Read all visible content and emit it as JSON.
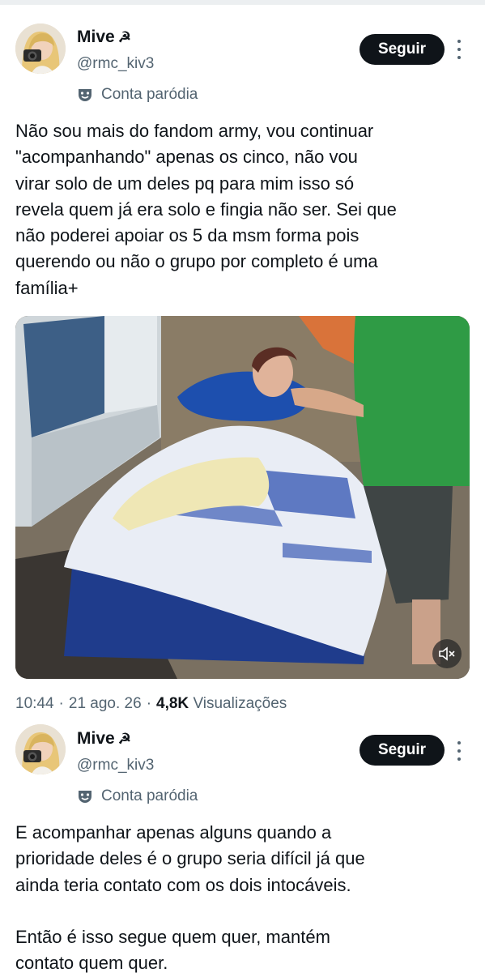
{
  "tweets": [
    {
      "author": {
        "name": "Mive",
        "symbol": "☭",
        "handle": "@rmc_kiv3",
        "avatar_icon": "avatar-photo-camera"
      },
      "follow_label": "Seguir",
      "parody_label": "Conta paródia",
      "text": "Não sou mais do fandom army, vou continuar\n\"acompanhando\" apenas os cinco, não vou\nvirar solo de um deles pq para mim isso só\nrevela quem já era solo e fingia não ser. Sei que\nnão poderei apoiar os 5 da msm forma pois\nquerendo ou não o grupo por completo é uma\nfamília+",
      "media": {
        "type": "video",
        "muted_icon": "speaker-muted-icon"
      },
      "meta": {
        "time": "10:44",
        "date": "21 ago. 26",
        "views_count": "4,8K",
        "views_label": "Visualizações",
        "separator": "·"
      }
    },
    {
      "author": {
        "name": "Mive",
        "symbol": "☭",
        "handle": "@rmc_kiv3",
        "avatar_icon": "avatar-photo-camera"
      },
      "follow_label": "Seguir",
      "parody_label": "Conta paródia",
      "text": "E acompanhar apenas alguns quando a\nprioridade deles é o grupo seria difícil já que\nainda teria contato com os dois intocáveis.\n\nEntão é isso segue quem quer, mantém\ncontato quem quer."
    }
  ],
  "colors": {
    "text": "#0f1419",
    "secondary": "#536471",
    "button_bg": "#0f1419",
    "button_text": "#ffffff"
  }
}
